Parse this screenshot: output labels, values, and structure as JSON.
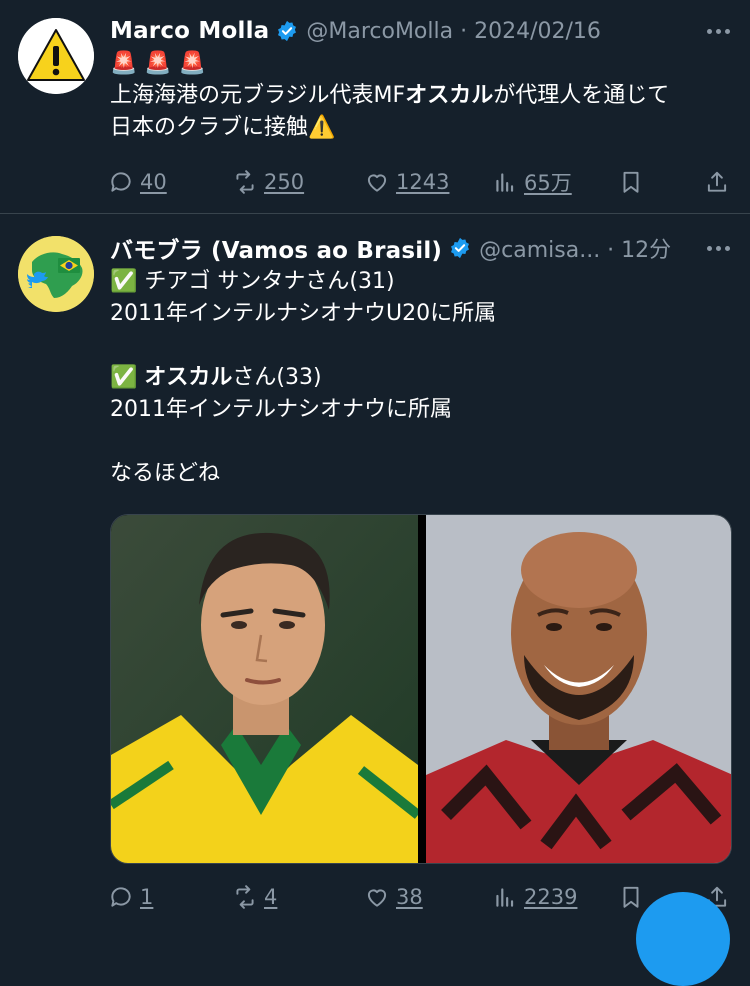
{
  "tweets": [
    {
      "name": "Marco Molla",
      "handle": "@MarcoMolla · 2024/02/16",
      "avatar_icon": "warning-sign-icon",
      "lines": [
        "🚨 🚨 🚨",
        "上海海港の元ブラジル代表MF",
        "オスカル",
        "が代理人を通じて",
        "日本のクラブに接触⚠️"
      ],
      "stats": {
        "replies": "40",
        "retweets": "250",
        "likes": "1243",
        "views": "65万"
      }
    },
    {
      "name": "バモブラ (Vamos ao Brasil)",
      "handle": "@camisa... · 12分",
      "avatar_icon": "brazil-map-twitter-bird-icon",
      "lines": [
        "✅ チアゴ サンタナさん(31)",
        "2011年インテルナシオナウU20に所属",
        "✅ ",
        "オスカル",
        "さん(33)",
        "2011年インテルナシオナウに所属",
        "なるほどね"
      ],
      "media": {
        "left_photo": "player-in-yellow-brazil-jacket",
        "right_photo": "smiling-bald-player-in-red-black-jersey"
      },
      "stats": {
        "replies": "1",
        "retweets": "4",
        "likes": "38",
        "views": "2239"
      }
    }
  ],
  "colors": {
    "background": "#15202b",
    "secondary_text": "#8b98a5",
    "verified": "#1d9bf0",
    "divider": "#38444d"
  }
}
